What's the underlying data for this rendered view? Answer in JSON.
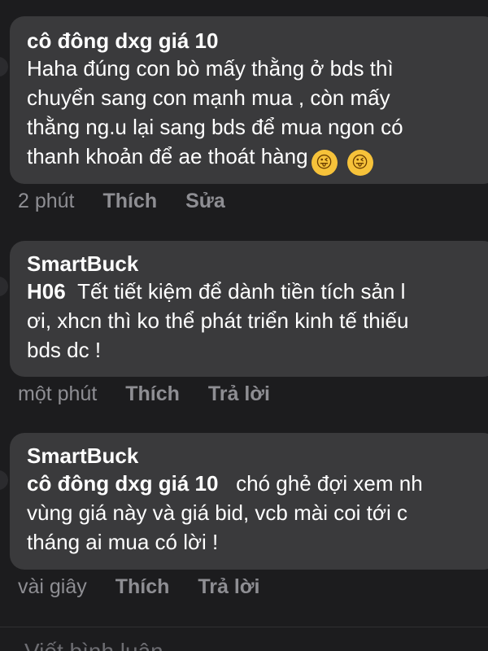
{
  "comments": [
    {
      "author": "cô đông dxg giá 10",
      "lines": [
        "Haha đúng con bò mấy thằng ở bds thì",
        "chuyển sang con mạnh mua , còn mấy",
        "thằng ng.u lại sang bds để mua ngon có",
        "thanh khoản để ae thoát hàng"
      ],
      "emojis": [
        "zany-face-emoji",
        "zany-face-emoji"
      ],
      "time": "2 phút",
      "like_label": "Thích",
      "action_label": "Sửa"
    },
    {
      "author": "SmartBuck",
      "mention": "H06",
      "lines": [
        "Tết tiết kiệm để dành tiền tích sản l",
        "ơi, xhcn thì ko thể phát triển kinh tế thiếu",
        "bds dc !"
      ],
      "time": "một phút",
      "like_label": "Thích",
      "action_label": "Trả lời"
    },
    {
      "author": "SmartBuck",
      "mention": "cô đông dxg giá 10",
      "lines": [
        "chó ghẻ đợi xem nh",
        "vùng giá này và giá bid, vcb mài coi tới c",
        "tháng ai mua có lời !"
      ],
      "time": "vài giây",
      "like_label": "Thích",
      "action_label": "Trả lời"
    }
  ],
  "composer": {
    "placeholder": "Viết bình luận..."
  }
}
